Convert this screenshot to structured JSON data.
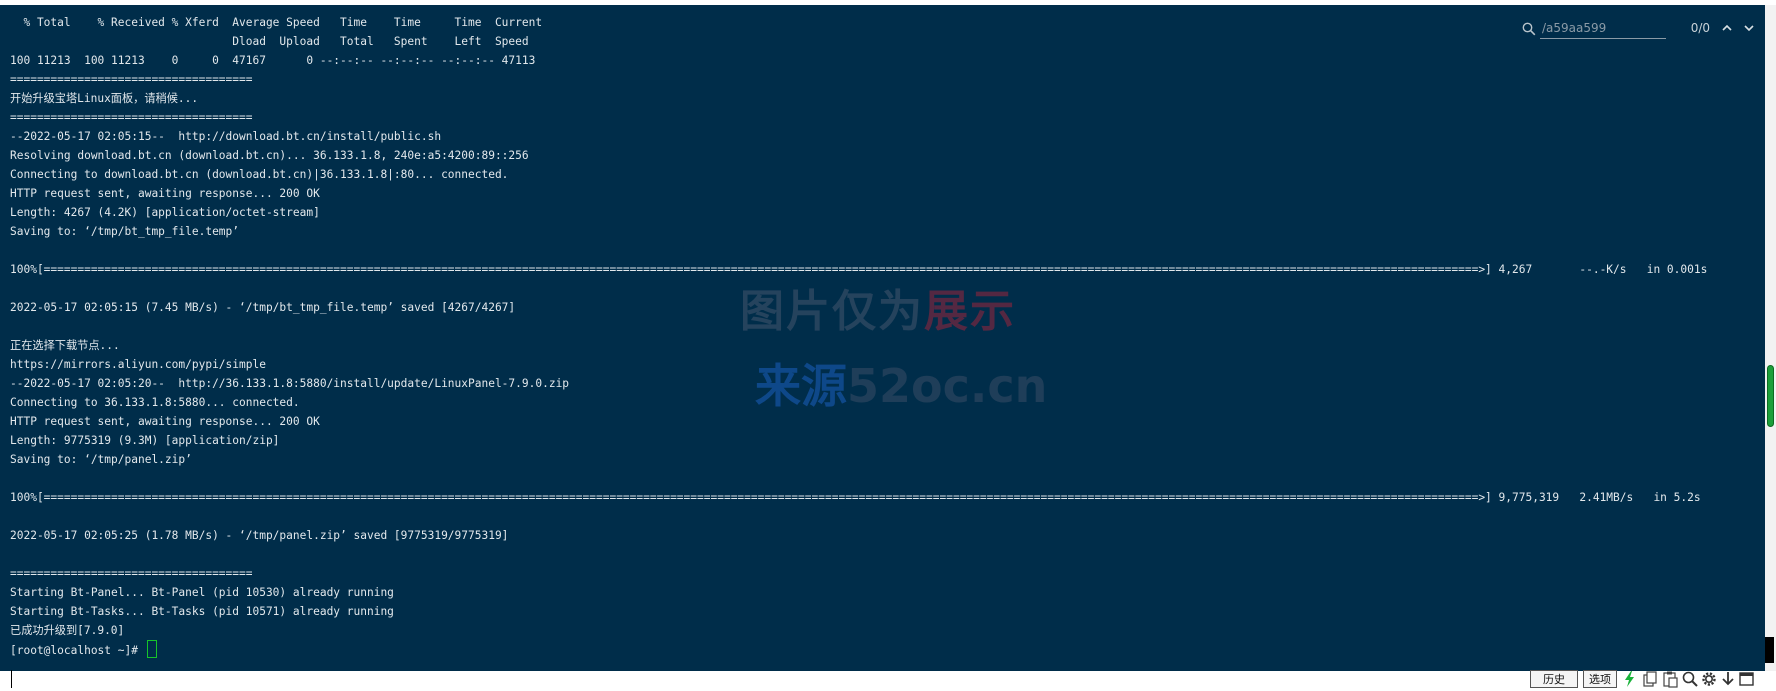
{
  "terminal": {
    "lines": [
      "  % Total    % Received % Xferd  Average Speed   Time    Time     Time  Current",
      "                                 Dload  Upload   Total   Spent    Left  Speed",
      "100 11213  100 11213    0     0  47167      0 --:--:-- --:--:-- --:--:-- 47113",
      "====================================",
      "开始升级宝塔Linux面板，请稍候...",
      "====================================",
      "--2022-05-17 02:05:15--  http://download.bt.cn/install/public.sh",
      "Resolving download.bt.cn (download.bt.cn)... 36.133.1.8, 240e:a5:4200:89::256",
      "Connecting to download.bt.cn (download.bt.cn)|36.133.1.8|:80... connected.",
      "HTTP request sent, awaiting response... 200 OK",
      "Length: 4267 (4.2K) [application/octet-stream]",
      "Saving to: ‘/tmp/bt_tmp_file.temp’",
      "",
      "100%[=====================================================================================================================================================================================================================>] 4,267       --.-K/s   in 0.001s",
      "",
      "2022-05-17 02:05:15 (7.45 MB/s) - ‘/tmp/bt_tmp_file.temp’ saved [4267/4267]",
      "",
      "正在选择下载节点...",
      "https://mirrors.aliyun.com/pypi/simple",
      "--2022-05-17 02:05:20--  http://36.133.1.8:5880/install/update/LinuxPanel-7.9.0.zip",
      "Connecting to 36.133.1.8:5880... connected.",
      "HTTP request sent, awaiting response... 200 OK",
      "Length: 9775319 (9.3M) [application/zip]",
      "Saving to: ‘/tmp/panel.zip’",
      "",
      "100%[=====================================================================================================================================================================================================================>] 9,775,319   2.41MB/s   in 5.2s",
      "",
      "2022-05-17 02:05:25 (1.78 MB/s) - ‘/tmp/panel.zip’ saved [9775319/9775319]",
      "",
      "====================================",
      "Starting Bt-Panel... Bt-Panel (pid 10530) already running",
      "Starting Bt-Tasks... Bt-Tasks (pid 10571) already running",
      "已成功升级到[7.9.0]"
    ],
    "prompt": "[root@localhost ~]# "
  },
  "search": {
    "value": "/a59aa599",
    "match_count": "0/0"
  },
  "watermark": {
    "line1_part1": "图片仅为",
    "line1_part2": "展示",
    "line2_part1": "来源",
    "line2_part2": "52oc.cn"
  },
  "bottom_bar": {
    "history_label": "历史",
    "options_label": "选项"
  },
  "colors": {
    "terminal_bg": "#002d4a",
    "terminal_fg": "#e2e8ec",
    "cursor": "#16c32a",
    "scroll_thumb": "#1c9f3a"
  },
  "icons": {
    "search": "search-icon",
    "prev": "chevron-up-icon",
    "next": "chevron-down-icon",
    "close": "close-icon",
    "bolt": "lightning-icon",
    "copy": "copy-icon",
    "paste": "paste-icon",
    "find": "magnifier-icon",
    "settings": "gear-icon",
    "download": "download-icon",
    "window": "window-icon"
  }
}
